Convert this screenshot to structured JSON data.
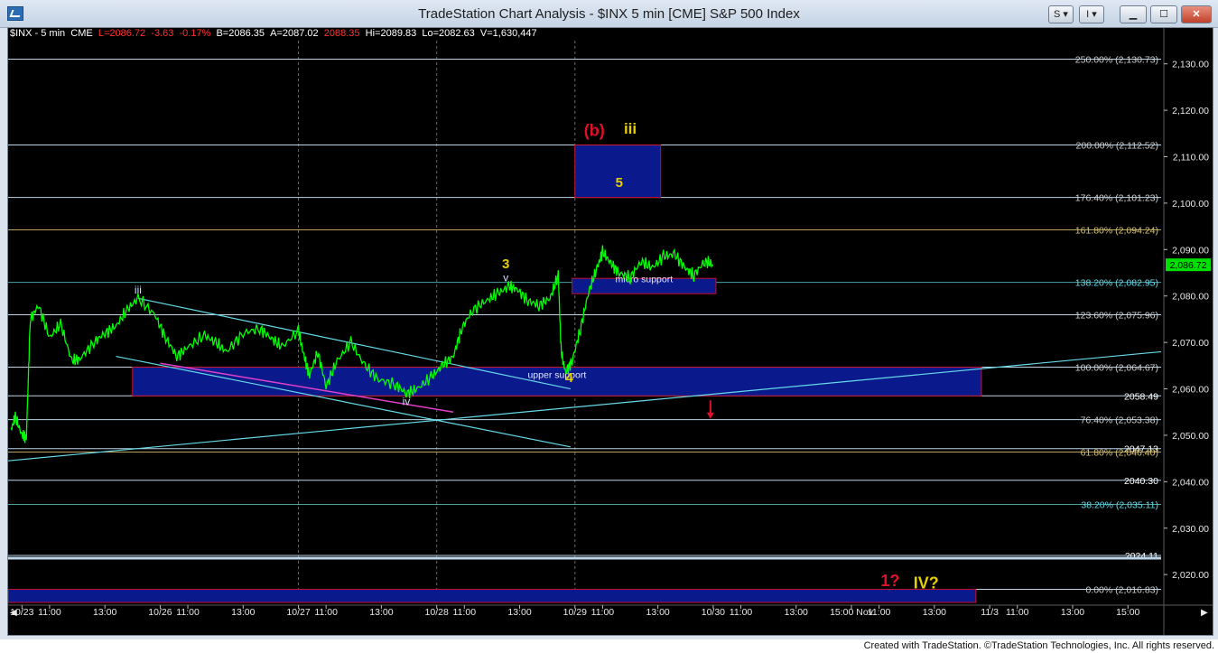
{
  "window": {
    "title": "TradeStation Chart Analysis - $INX 5 min [CME] S&P 500 Index",
    "buttons": [
      "S",
      "I"
    ]
  },
  "status": {
    "symbol": "$INX - 5 min",
    "exchange": "CME",
    "last": "L=2086.72",
    "change": "-3.63",
    "change_pct": "-0.17%",
    "bid": "B=2086.35",
    "ask": "A=2087.02",
    "prev": "2088.35",
    "high": "Hi=2089.83",
    "low": "Lo=2082.63",
    "volume": "V=1,630,447"
  },
  "footer": "Created with TradeStation. ©TradeStation Technologies, Inc. All rights reserved.",
  "colors": {
    "background": "#000000",
    "price": "#00ff00",
    "trendline": "#66d9e8",
    "zone_fill": "#0a1a8c",
    "zone_border": "#c8102e",
    "wave_red": "#e0102a",
    "wave_yellow": "#e8d000",
    "fib_text": "#cfcfcf"
  },
  "chart_data": {
    "type": "line",
    "ylim": [
      2014,
      2135
    ],
    "y_ticks": [
      2020,
      2030,
      2040,
      2050,
      2060,
      2070,
      2080,
      2090,
      2100,
      2110,
      2120,
      2130
    ],
    "y_tick_labels": [
      "2,020.00",
      "2,030.00",
      "2,040.00",
      "2,050.00",
      "2,060.00",
      "2,070.00",
      "2,080.00",
      "2,090.00",
      "2,100.00",
      "2,110.00",
      "2,120.00",
      "2,130.00"
    ],
    "last_price_label": "2,086.72",
    "x_labels": [
      {
        "t": 0.0,
        "label": "10/23"
      },
      {
        "t": 0.5,
        "label": "11:00"
      },
      {
        "t": 1.5,
        "label": "13:00"
      },
      {
        "t": 2.5,
        "label": "10/26"
      },
      {
        "t": 3.0,
        "label": "11:00"
      },
      {
        "t": 4.0,
        "label": "13:00"
      },
      {
        "t": 5.0,
        "label": "10/27"
      },
      {
        "t": 5.5,
        "label": "11:00"
      },
      {
        "t": 6.5,
        "label": "13:00"
      },
      {
        "t": 7.5,
        "label": "10/28"
      },
      {
        "t": 8.0,
        "label": "11:00"
      },
      {
        "t": 9.0,
        "label": "13:00"
      },
      {
        "t": 10.0,
        "label": "10/29"
      },
      {
        "t": 10.5,
        "label": "11:00"
      },
      {
        "t": 11.5,
        "label": "13:00"
      },
      {
        "t": 12.5,
        "label": "10/30"
      },
      {
        "t": 13.0,
        "label": "11:00"
      },
      {
        "t": 14.0,
        "label": "13:00"
      },
      {
        "t": 15.0,
        "label": "15:00 Nov"
      },
      {
        "t": 15.5,
        "label": "11:00"
      },
      {
        "t": 16.5,
        "label": "13:00"
      },
      {
        "t": 17.5,
        "label": "11/3"
      },
      {
        "t": 18.0,
        "label": "11:00"
      },
      {
        "t": 19.0,
        "label": "13:00"
      },
      {
        "t": 20.0,
        "label": "15:00"
      }
    ],
    "x_range": [
      -0.25,
      20.6
    ],
    "day_separators": [
      5.0,
      7.5,
      10.0
    ],
    "series": [
      {
        "points": [
          [
            -0.2,
            2051.0
          ],
          [
            -0.12,
            2054.0
          ],
          [
            0.0,
            2050.0
          ],
          [
            0.08,
            2049.5
          ],
          [
            0.15,
            2075.0
          ],
          [
            0.3,
            2078.0
          ],
          [
            0.5,
            2071.0
          ],
          [
            0.7,
            2074.0
          ],
          [
            0.9,
            2066.0
          ],
          [
            1.05,
            2066.5
          ],
          [
            1.3,
            2070.0
          ],
          [
            1.5,
            2072.0
          ],
          [
            1.7,
            2073.5
          ],
          [
            1.9,
            2077.0
          ],
          [
            2.1,
            2079.5
          ],
          [
            2.4,
            2076.0
          ],
          [
            2.6,
            2071.0
          ],
          [
            2.8,
            2067.0
          ],
          [
            3.0,
            2069.0
          ],
          [
            3.3,
            2071.5
          ],
          [
            3.5,
            2070.0
          ],
          [
            3.7,
            2068.0
          ],
          [
            4.0,
            2072.0
          ],
          [
            4.3,
            2073.0
          ],
          [
            4.5,
            2071.0
          ],
          [
            4.7,
            2069.0
          ],
          [
            5.0,
            2072.5
          ],
          [
            5.1,
            2067.0
          ],
          [
            5.2,
            2063.0
          ],
          [
            5.35,
            2068.0
          ],
          [
            5.5,
            2060.5
          ],
          [
            5.7,
            2066.0
          ],
          [
            5.95,
            2070.0
          ],
          [
            6.2,
            2065.0
          ],
          [
            6.45,
            2062.0
          ],
          [
            6.75,
            2061.0
          ],
          [
            6.95,
            2059.0
          ],
          [
            7.15,
            2060.0
          ],
          [
            7.4,
            2062.5
          ],
          [
            7.6,
            2065.0
          ],
          [
            7.8,
            2067.0
          ],
          [
            7.95,
            2073.0
          ],
          [
            8.15,
            2077.0
          ],
          [
            8.4,
            2079.0
          ],
          [
            8.6,
            2080.5
          ],
          [
            8.8,
            2082.0
          ],
          [
            8.95,
            2081.5
          ],
          [
            9.15,
            2079.0
          ],
          [
            9.35,
            2078.0
          ],
          [
            9.55,
            2079.5
          ],
          [
            9.7,
            2084.5
          ],
          [
            9.75,
            2068.0
          ],
          [
            9.83,
            2063.5
          ],
          [
            9.95,
            2066.0
          ],
          [
            10.1,
            2073.0
          ],
          [
            10.25,
            2081.0
          ],
          [
            10.4,
            2086.0
          ],
          [
            10.5,
            2089.5
          ],
          [
            10.65,
            2087.0
          ],
          [
            10.8,
            2085.0
          ],
          [
            11.0,
            2084.0
          ],
          [
            11.2,
            2087.5
          ],
          [
            11.4,
            2086.0
          ],
          [
            11.6,
            2088.5
          ],
          [
            11.8,
            2089.0
          ],
          [
            12.0,
            2086.0
          ],
          [
            12.15,
            2084.5
          ],
          [
            12.35,
            2087.5
          ],
          [
            12.5,
            2086.72
          ]
        ]
      }
    ],
    "fib_levels": [
      {
        "value": 2131.0,
        "label": "250.00% (2,130.73)",
        "color": "#cfcfcf",
        "line": "#bcd4e6"
      },
      {
        "value": 2112.52,
        "label": "200.00% (2,112.52)",
        "color": "#cfcfcf",
        "line": "#bcd4e6"
      },
      {
        "value": 2101.23,
        "label": "176.40% (2,101.23)",
        "color": "#cfcfcf",
        "line": "#bcd4e6"
      },
      {
        "value": 2094.24,
        "label": "161.80% (2,094.24)",
        "color": "#d8c070",
        "line": "#b9a45a"
      },
      {
        "value": 2082.95,
        "label": "138.20% (2,082.95)",
        "color": "#66d9e8",
        "line": "#4aa3a3"
      },
      {
        "value": 2075.96,
        "label": "123.60% (2,075.96)",
        "color": "#cfcfcf",
        "line": "#bcd4e6"
      },
      {
        "value": 2064.67,
        "label": "100.00% (2,064.67)",
        "color": "#cfcfcf",
        "line": "#bcd4e6"
      },
      {
        "value": 2058.49,
        "label": "2058.49",
        "color": "#ffffff",
        "line": "#bcd4e6"
      },
      {
        "value": 2053.38,
        "label": "76.40% (2,053.38)",
        "color": "#cfcfcf",
        "line": "#bcd4e6"
      },
      {
        "value": 2047.13,
        "label": "2047.13",
        "color": "#ffffff",
        "line": "#bcd4e6"
      },
      {
        "value": 2046.4,
        "label": "61.80% (2,046.40)",
        "color": "#d8c070",
        "line": "#b9a45a"
      },
      {
        "value": 2040.3,
        "label": "2040.30",
        "color": "#ffffff",
        "line": "#bcd4e6"
      },
      {
        "value": 2035.11,
        "label": "38.20% (2,035.11)",
        "color": "#66d9e8",
        "line": "#4aa3a3"
      },
      {
        "value": 2024.11,
        "label": "2024.11",
        "color": "#ffffff",
        "line": "#bcd4e6"
      },
      {
        "value": 2016.83,
        "label": "0.00% (2,016.83)",
        "color": "#cfcfcf",
        "line": "#bcd4e6"
      }
    ],
    "zones": [
      {
        "label": "",
        "x0": 10.0,
        "x1": 11.55,
        "y0": 2101.23,
        "y1": 2112.52
      },
      {
        "label": "micro support",
        "x0": 9.95,
        "x1": 12.55,
        "y0": 2080.5,
        "y1": 2083.8
      },
      {
        "label": "upper support",
        "x0": 2.0,
        "x1": 17.35,
        "y0": 2058.49,
        "y1": 2064.67
      },
      {
        "label": "",
        "x0": -0.25,
        "x1": 17.25,
        "y0": 2014.0,
        "y1": 2016.83
      }
    ],
    "trendlines": [
      {
        "from": [
          2.1,
          2079.5
        ],
        "to": [
          9.92,
          2060.0
        ]
      },
      {
        "from": [
          1.7,
          2067.0
        ],
        "to": [
          9.92,
          2047.5
        ]
      },
      {
        "from": [
          -0.25,
          2044.5
        ],
        "to": [
          20.6,
          2068.0
        ]
      }
    ],
    "magenta_line": {
      "from": [
        2.5,
        2065.5
      ],
      "to": [
        7.8,
        2055.0
      ]
    },
    "wave_labels": [
      {
        "text": "iii",
        "t": 2.1,
        "y": 2080.5,
        "color": "#cfe0ff",
        "size": 12,
        "bold": false
      },
      {
        "text": "iv",
        "t": 6.95,
        "y": 2056.5,
        "color": "#cfe0ff",
        "size": 12,
        "bold": false
      },
      {
        "text": "v",
        "t": 8.75,
        "y": 2083.2,
        "color": "#cfe0ff",
        "size": 12,
        "bold": false
      },
      {
        "text": "3",
        "t": 8.75,
        "y": 2086.0,
        "color": "#e8d000",
        "size": 15,
        "bold": true
      },
      {
        "text": "4",
        "t": 9.9,
        "y": 2061.5,
        "color": "#e8d000",
        "size": 15,
        "bold": true
      },
      {
        "text": "(b)",
        "t": 10.35,
        "y": 2114.5,
        "color": "#e0102a",
        "size": 18,
        "bold": true
      },
      {
        "text": "iii",
        "t": 11.0,
        "y": 2115.0,
        "color": "#e8d000",
        "size": 17,
        "bold": true
      },
      {
        "text": "5",
        "t": 10.8,
        "y": 2103.5,
        "color": "#e8d000",
        "size": 15,
        "bold": true
      },
      {
        "text": "1?",
        "t": 15.7,
        "y": 2017.5,
        "color": "#e0102a",
        "size": 18,
        "bold": true
      },
      {
        "text": "IV?",
        "t": 16.35,
        "y": 2017.0,
        "color": "#e8d000",
        "size": 18,
        "bold": true
      }
    ],
    "arrow": {
      "t": 12.45,
      "y_from": 2057.5,
      "y_to": 2054.5,
      "color": "#e0102a"
    }
  }
}
